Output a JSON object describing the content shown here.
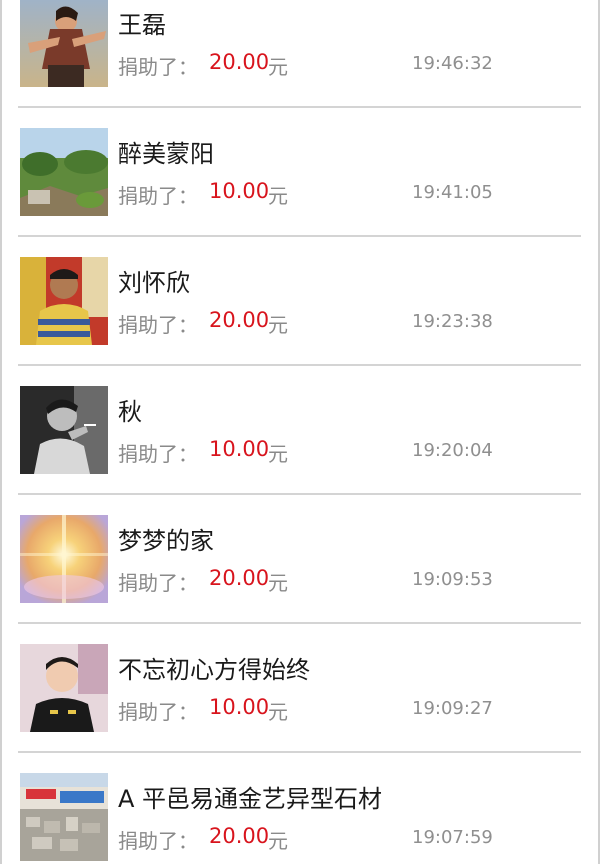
{
  "donation_list": {
    "items": [
      {
        "name": "王磊",
        "action_label": "捐助了：",
        "amount": "20.00",
        "currency": "元",
        "time": "19:46:32",
        "avatar": "warrior-art-avatar"
      },
      {
        "name": "醉美蒙阳",
        "action_label": "捐助了：",
        "amount": "10.00",
        "currency": "元",
        "time": "19:41:05",
        "avatar": "landscape-avatar"
      },
      {
        "name": "刘怀欣",
        "action_label": "捐助了：",
        "amount": "20.00",
        "currency": "元",
        "time": "19:23:38",
        "avatar": "man-photo-avatar"
      },
      {
        "name": "秋",
        "action_label": "捐助了：",
        "amount": "10.00",
        "currency": "元",
        "time": "19:20:04",
        "avatar": "bw-smoking-man-avatar"
      },
      {
        "name": "梦梦的家",
        "action_label": "捐助了：",
        "amount": "20.00",
        "currency": "元",
        "time": "19:09:53",
        "avatar": "golden-light-avatar"
      },
      {
        "name": "不忘初心方得始终",
        "action_label": "捐助了：",
        "amount": "10.00",
        "currency": "元",
        "time": "19:09:27",
        "avatar": "young-man-avatar"
      },
      {
        "name": "A 平邑易通金艺异型石材",
        "action_label": "捐助了：",
        "amount": "20.00",
        "currency": "元",
        "time": "19:07:59",
        "avatar": "stone-factory-avatar"
      }
    ]
  },
  "colors": {
    "amount": "#d8141d",
    "label": "#8a8a8a",
    "name": "#1a1a1a",
    "divider": "#d4d4d4"
  }
}
